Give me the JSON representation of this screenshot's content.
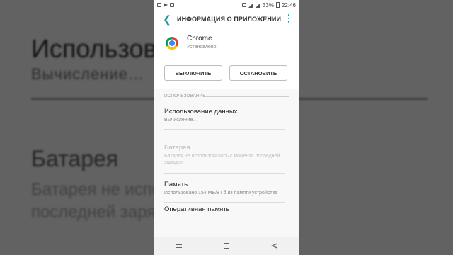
{
  "background": {
    "heading1": "Использова",
    "sub1": "Вычисление…",
    "heading2": "Батарея",
    "sub2_line1": "Батарея не испо          мента",
    "sub2_line2": "последней заря"
  },
  "statusbar": {
    "battery_percent": "33%",
    "time": "22:46"
  },
  "appbar": {
    "title": "ИНФОРМАЦИЯ О ПРИЛОЖЕНИИ",
    "back_icon": "chevron-left-icon",
    "menu_icon": "more-vert-icon"
  },
  "app": {
    "name": "Chrome",
    "status": "Установлено",
    "disable_label": "ВЫКЛЮЧИТЬ",
    "stop_label": "ОСТАНОВИТЬ"
  },
  "section": {
    "usage_header": "ИСПОЛЬЗОВАНИЕ"
  },
  "items": [
    {
      "title": "Использование данных",
      "subtitle": "Вычисление…"
    },
    {
      "title": "Батарея",
      "subtitle": "Батарея не использовалась с момента последней зарядки"
    },
    {
      "title": "Память",
      "subtitle": "Использовано 154 МБ/8 Гб из памяти устройства"
    },
    {
      "title": "Оперативная память",
      "subtitle": ""
    }
  ],
  "colors": {
    "accent": "#2196a7",
    "screen_bg": "#f8f8f8"
  }
}
